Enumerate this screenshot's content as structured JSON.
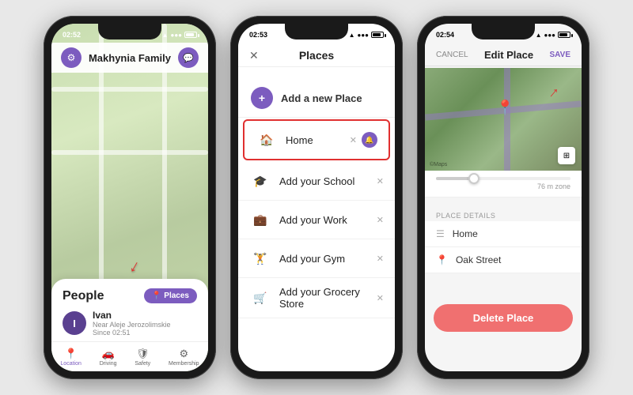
{
  "phone1": {
    "status_time": "02:52",
    "family_name": "Makhynia Family",
    "people_label": "People",
    "places_btn": "Places",
    "person": {
      "initial": "I",
      "name": "Ivan",
      "location": "Near Aleje Jerozolimskie",
      "since": "Since 02:51"
    },
    "nav": [
      {
        "label": "Location",
        "icon": "📍",
        "active": true
      },
      {
        "label": "Driving",
        "icon": "🚗",
        "active": false
      },
      {
        "label": "Safety",
        "icon": "🛡",
        "active": false
      },
      {
        "label": "Membership",
        "icon": "⚙",
        "active": false
      }
    ]
  },
  "phone2": {
    "status_time": "02:53",
    "title": "Places",
    "add_label": "Add a new Place",
    "items": [
      {
        "label": "Home",
        "icon": "🏠",
        "highlighted": true
      },
      {
        "label": "Add your School",
        "icon": "🎓",
        "highlighted": false
      },
      {
        "label": "Add your Work",
        "icon": "💼",
        "highlighted": false
      },
      {
        "label": "Add your Gym",
        "icon": "🏋",
        "highlighted": false
      },
      {
        "label": "Add your Grocery Store",
        "icon": "🛒",
        "highlighted": false
      }
    ]
  },
  "phone3": {
    "status_time": "02:54",
    "cancel_label": "CANCEL",
    "title": "Edit Place",
    "save_label": "SAVE",
    "map_watermark": "©Maps",
    "radius_label": "76 m zone",
    "place_details_title": "Place details",
    "detail_name": "Home",
    "detail_address": "Oak Street",
    "delete_btn": "Delete Place"
  },
  "colors": {
    "purple": "#7c5cbf",
    "red": "#e03030",
    "light_red": "#f07070"
  }
}
